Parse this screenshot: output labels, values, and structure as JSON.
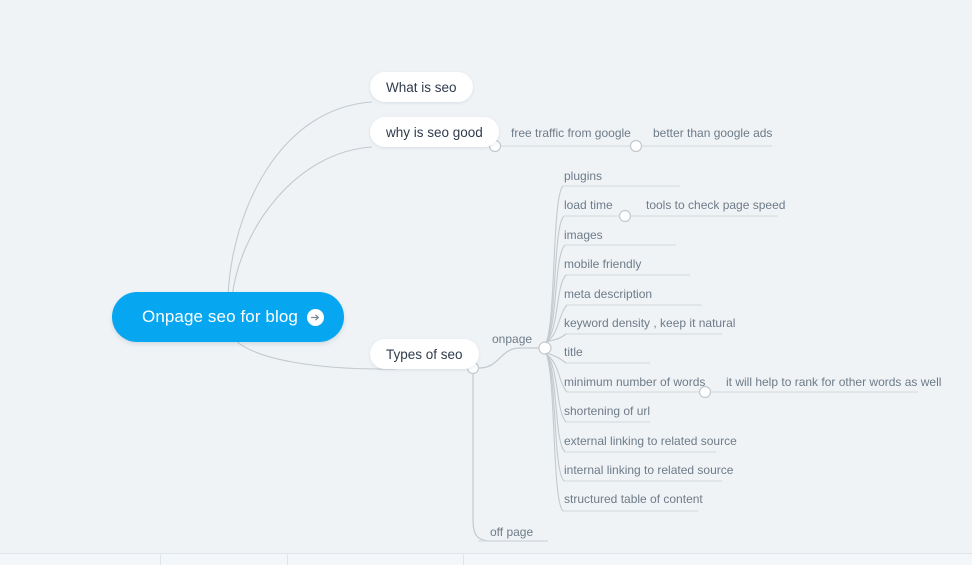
{
  "root": {
    "label": "Onpage seo for blog",
    "icon": "arrow-right-circle-icon",
    "color": "#06a7f0",
    "text_color": "#ffffff"
  },
  "theme": {
    "background": "#eff3f6",
    "link_color": "#c3c9cd",
    "pill_background": "#ffffff",
    "pill_text": "#2f3b4c",
    "leaf_text": "#6e7b88"
  },
  "branches": [
    {
      "id": "what-is-seo",
      "label": "What is seo",
      "style": "pill",
      "children": []
    },
    {
      "id": "why-is-seo-good",
      "label": "why is seo good",
      "style": "pill",
      "children": [
        {
          "id": "free-traffic-from-google",
          "label": "free traffic from google"
        },
        {
          "id": "better-than-google-ads",
          "label": "better than google ads"
        }
      ]
    },
    {
      "id": "types-of-seo",
      "label": "Types of seo",
      "style": "pill",
      "children": [
        {
          "id": "onpage",
          "label": "onpage",
          "children": [
            {
              "id": "plugins",
              "label": "plugins"
            },
            {
              "id": "load-time",
              "label": "load time",
              "children": [
                {
                  "id": "tools-to-check-page-speed",
                  "label": "tools to check page speed"
                }
              ]
            },
            {
              "id": "images",
              "label": "images"
            },
            {
              "id": "mobile-friendly",
              "label": "mobile friendly"
            },
            {
              "id": "meta-description",
              "label": "meta description"
            },
            {
              "id": "keyword-density",
              "label": "keyword density , keep it natural"
            },
            {
              "id": "title",
              "label": "title"
            },
            {
              "id": "minimum-number-of-words",
              "label": "minimum number of words",
              "children": [
                {
                  "id": "rank-other-words",
                  "label": "it will help to rank for other words as well"
                }
              ]
            },
            {
              "id": "shortening-of-url",
              "label": "shortening of url"
            },
            {
              "id": "external-linking",
              "label": "external linking to related source"
            },
            {
              "id": "internal-linking",
              "label": "internal linking to related source"
            },
            {
              "id": "structured-table-of-content",
              "label": "structured table of content"
            }
          ]
        },
        {
          "id": "off-page",
          "label": "off page",
          "children": []
        }
      ]
    }
  ]
}
